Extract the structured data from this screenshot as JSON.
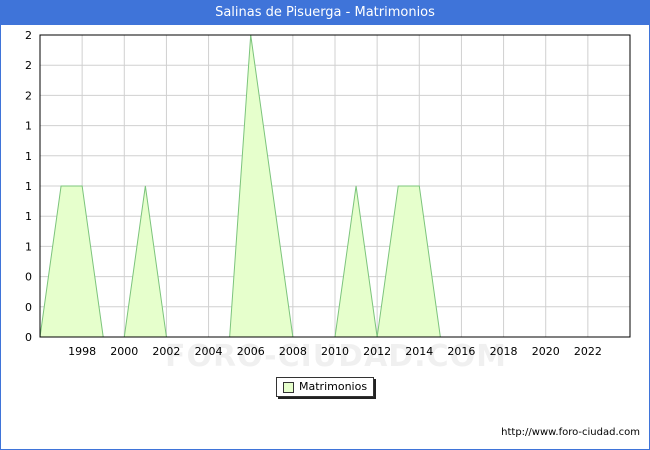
{
  "title": "Salinas de Pisuerga - Matrimonios",
  "watermark": "FORO-CIUDAD.COM",
  "source_url": "http://www.foro-ciudad.com",
  "colors": {
    "header_bg": "#3f74d9",
    "area_fill": "#e6ffcc",
    "area_line": "#7cc47c",
    "grid": "#d0d0d0"
  },
  "chart_data": {
    "type": "area",
    "x": [
      1996,
      1997,
      1998,
      1999,
      2000,
      2001,
      2002,
      2003,
      2004,
      2005,
      2006,
      2007,
      2008,
      2009,
      2010,
      2011,
      2012,
      2013,
      2014,
      2015,
      2016,
      2017,
      2018,
      2019,
      2020,
      2021,
      2022,
      2023
    ],
    "series": [
      {
        "name": "Matrimonios",
        "values": [
          0,
          1,
          1,
          0,
          0,
          1,
          0,
          0,
          0,
          0,
          2,
          1,
          0,
          0,
          0,
          1,
          0,
          1,
          1,
          0,
          0,
          0,
          0,
          0,
          0,
          0,
          0,
          0
        ]
      }
    ],
    "xlim": [
      1996,
      2024
    ],
    "ylim": [
      0,
      2
    ],
    "x_ticks": [
      1998,
      2000,
      2002,
      2004,
      2006,
      2008,
      2010,
      2012,
      2014,
      2016,
      2018,
      2020,
      2022
    ],
    "y_tick_labels": [
      "0",
      "0",
      "0",
      "1",
      "1",
      "1",
      "1",
      "1",
      "2",
      "2",
      "2"
    ],
    "grid": true,
    "legend_position": "bottom-center"
  }
}
